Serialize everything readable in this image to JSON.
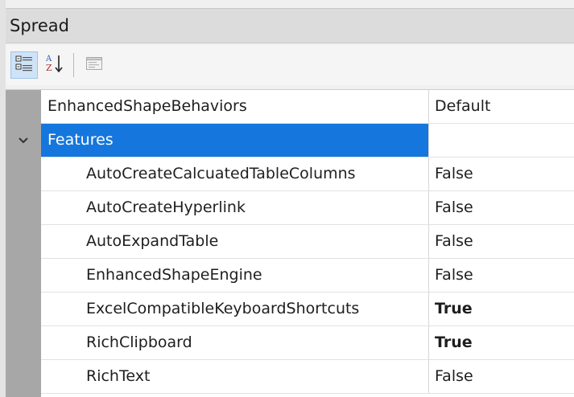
{
  "header": {
    "title": "Spread"
  },
  "toolbar": {
    "categorized_icon": "categorized-icon",
    "alphabetical_icon": "sort-az-icon",
    "property_pages_icon": "property-pages-icon"
  },
  "colors": {
    "selection": "#1577dd",
    "gutter": "#a7a7a7"
  },
  "rows": [
    {
      "name": "EnhancedShapeBehaviors",
      "value": "Default"
    },
    {
      "category": "Features",
      "expanded": true
    },
    {
      "name": "AutoCreateCalcuatedTableColumns",
      "value": "False"
    },
    {
      "name": "AutoCreateHyperlink",
      "value": "False"
    },
    {
      "name": "AutoExpandTable",
      "value": "False"
    },
    {
      "name": "EnhancedShapeEngine",
      "value": "False"
    },
    {
      "name": "ExcelCompatibleKeyboardShortcuts",
      "value": "True"
    },
    {
      "name": "RichClipboard",
      "value": "True"
    },
    {
      "name": "RichText",
      "value": "False"
    }
  ]
}
